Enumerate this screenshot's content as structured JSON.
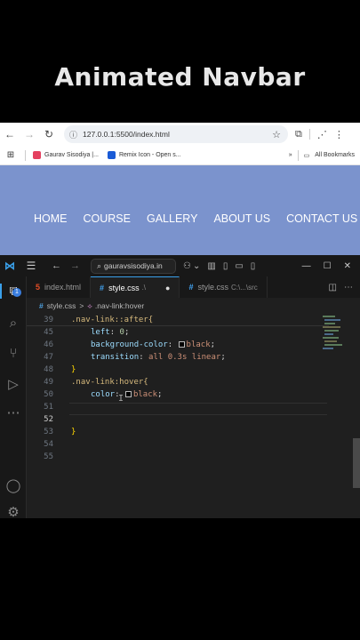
{
  "overlay_title": "Animated Navbar",
  "browser": {
    "address_url": "127.0.0.1:5500/index.html",
    "bookmarks": [
      {
        "label": "Gaurav Sisodiya |...",
        "color": "#e4405f"
      },
      {
        "label": "Remix Icon - Open s...",
        "color": "#1a5bd6"
      }
    ],
    "all_bookmarks_label": "All Bookmarks",
    "chevron_label": "»",
    "site_nav": [
      "HOME",
      "COURSE",
      "GALLERY",
      "ABOUT US",
      "CONTACT US"
    ],
    "site_bg_color": "#7b93cd"
  },
  "vscode": {
    "search_label": "gauravsisodiya.in",
    "tabs": [
      {
        "label": "index.html",
        "icon": "html-icon",
        "suffix": ""
      },
      {
        "label": "style.css",
        "icon": "css-icon",
        "suffix": ".\\"
      },
      {
        "label": "style.css",
        "icon": "css-icon",
        "suffix": "C:\\...\\src"
      }
    ],
    "breadcrumb": {
      "file": "style.css",
      "sep": ">",
      "symbol": ".nav-link:hover"
    },
    "badge_count": "1",
    "lines": [
      {
        "n": "39",
        "text": ".nav-link::after{"
      },
      {
        "n": "45",
        "prop": "left",
        "value": "0"
      },
      {
        "n": "46",
        "prop": "background-color",
        "value": "black"
      },
      {
        "n": "47",
        "prop": "transition",
        "value": "all 0.3s linear"
      },
      {
        "n": "48",
        "text": "}"
      },
      {
        "n": "49",
        "text": ".nav-link:hover{"
      },
      {
        "n": "50",
        "prop": "color",
        "value": "black"
      },
      {
        "n": "51",
        "text": ""
      },
      {
        "n": "52",
        "text": ""
      },
      {
        "n": "53",
        "text": "}"
      },
      {
        "n": "54",
        "text": ""
      },
      {
        "n": "55",
        "text": ""
      }
    ]
  }
}
